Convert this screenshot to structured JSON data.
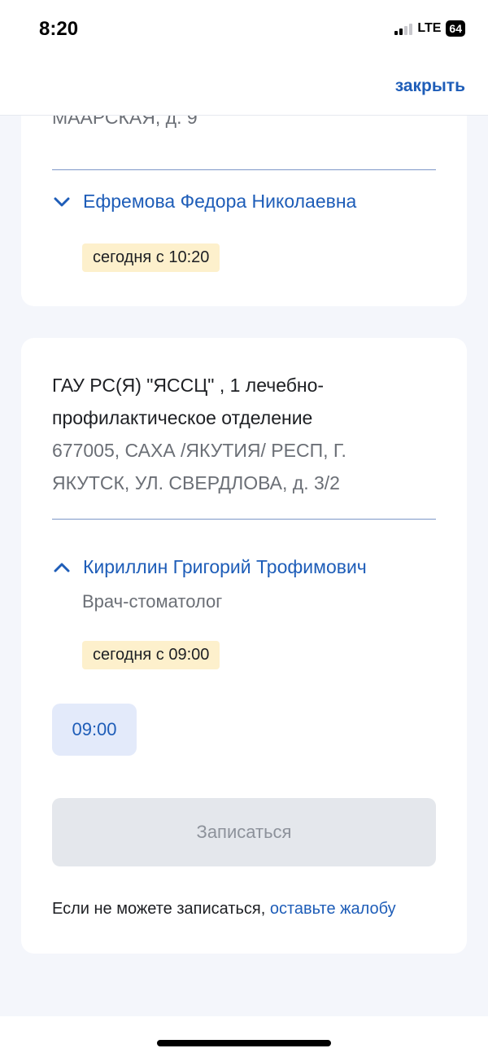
{
  "status": {
    "time": "8:20",
    "network": "LTE",
    "battery": "64"
  },
  "header": {
    "close_label": "закрыть"
  },
  "card1": {
    "address_tail": "МААРСКАЯ, д. 9",
    "doctor_name": "Ефремова Федора Николаевна",
    "availability": "сегодня с 10:20"
  },
  "card2": {
    "org_name": "ГАУ РС(Я) \"ЯССЦ\" , 1 лечебно-профилактическое отделение",
    "address_line1": "677005, САХА /ЯКУТИЯ/ РЕСП, Г.",
    "address_line2": "ЯКУТСК, УЛ. СВЕРДЛОВА, д. 3/2",
    "doctor_name": "Кириллин Григорий Трофимович",
    "specialty": "Врач-стоматолог",
    "availability": "сегодня с 09:00",
    "time_slots": [
      "09:00"
    ],
    "book_button": "Записаться",
    "complaint_text": "Если не можете записаться,",
    "complaint_link": "оставьте жалобу"
  },
  "icons": {
    "doctor1_toggle": "chevron-down-icon",
    "doctor2_toggle": "chevron-up-icon"
  },
  "colors": {
    "accent": "#1e5db8",
    "badge_bg": "#fdf0cc",
    "slot_bg": "#e3eafa",
    "disabled_btn_bg": "#e4e7ec",
    "page_bg": "#f4f6fb"
  }
}
